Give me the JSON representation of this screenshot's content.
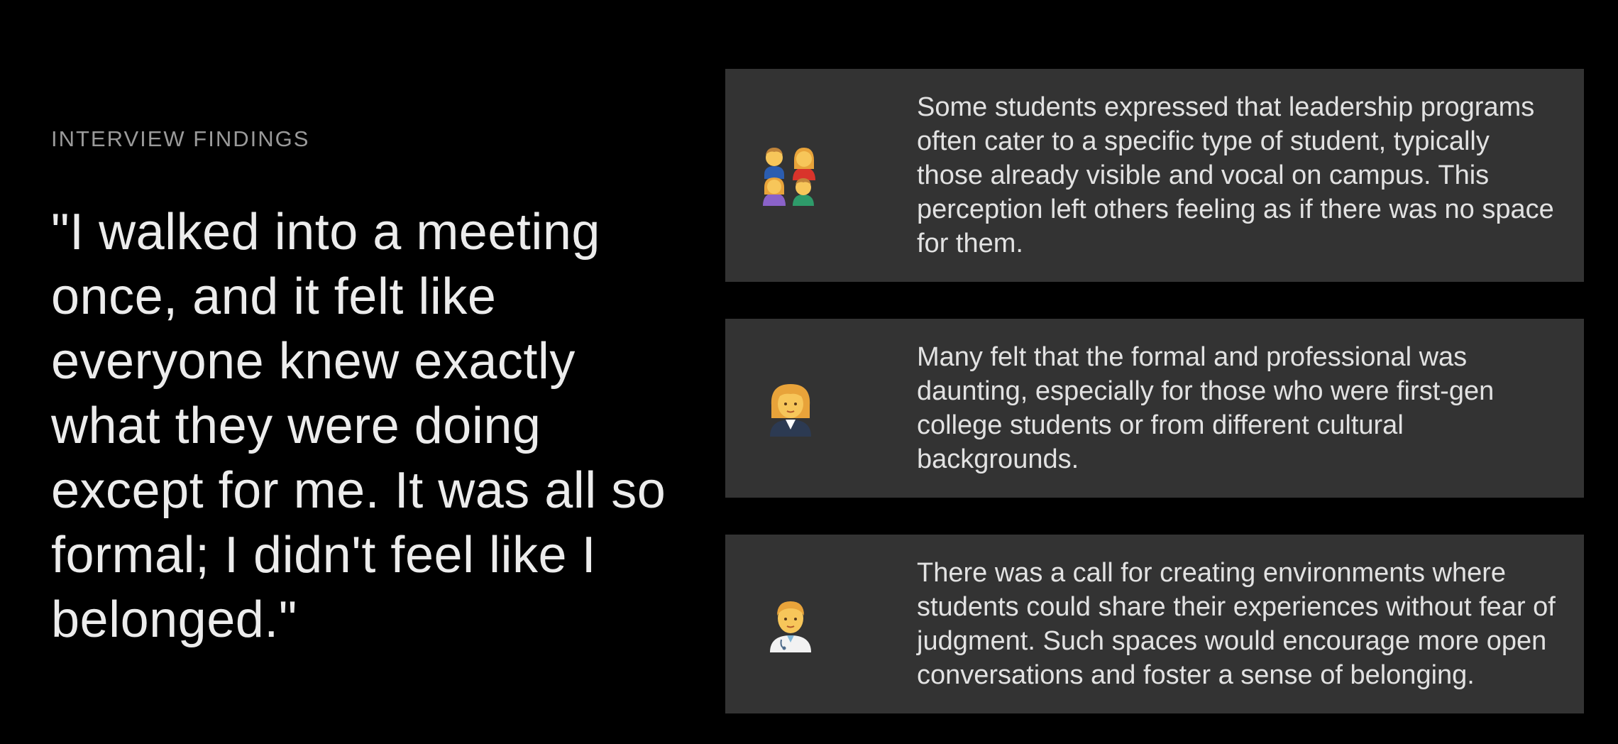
{
  "section": {
    "label": "INTERVIEW FINDINGS"
  },
  "quote": {
    "text": "\"I walked into a meeting once, and it felt like everyone knew exactly what they were doing except for me. It was all so formal; I didn't feel like I belonged.\""
  },
  "findings": [
    {
      "icon": "family-icon",
      "text": "Some students expressed that leadership programs often cater to a specific type of student, typically those already visible and vocal on campus. This perception left others feeling as if there was no space for them."
    },
    {
      "icon": "woman-professional-icon",
      "text": "Many felt that the formal and professional was daunting, especially for those who were first-gen college students or from different cultural backgrounds."
    },
    {
      "icon": "man-health-worker-icon",
      "text": "There was a call for creating environments where students could share their experiences without fear of judgment. Such spaces would encourage more open conversations and foster a sense of belonging."
    }
  ],
  "colors": {
    "background": "#000000",
    "card": "#333333",
    "label": "#9a9a9a",
    "quote": "#ececec",
    "card_text": "#e2e2e2"
  }
}
